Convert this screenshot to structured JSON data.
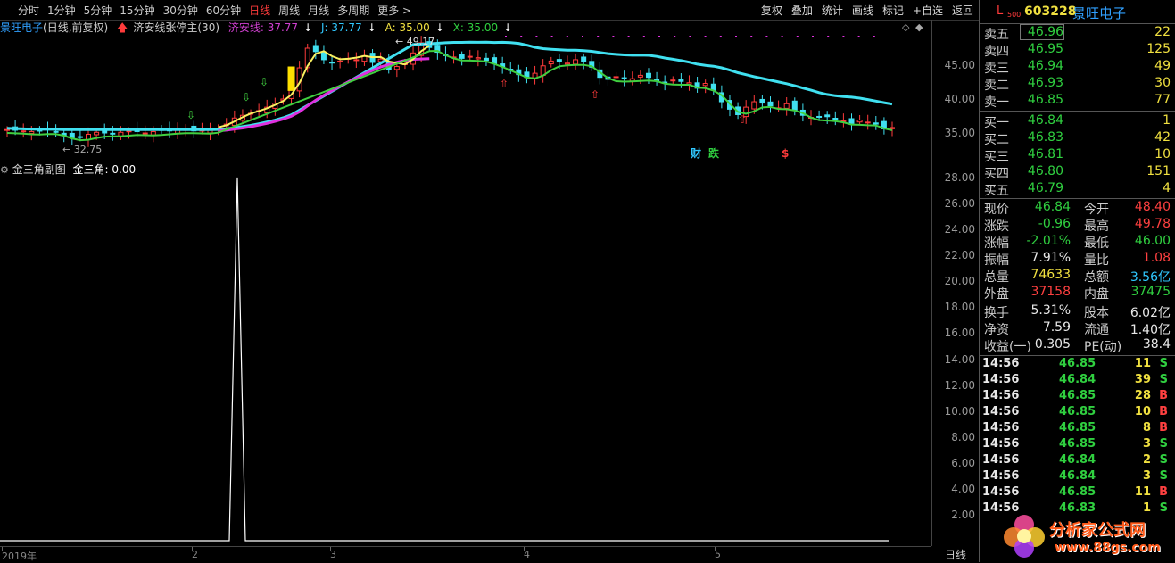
{
  "toolbar": {
    "periods": [
      "分时",
      "1分钟",
      "5分钟",
      "15分钟",
      "30分钟",
      "60分钟",
      "日线",
      "周线",
      "月线",
      "多周期",
      "更多"
    ],
    "active_period": "日线",
    "right_buttons": [
      "复权",
      "叠加",
      "统计",
      "画线",
      "标记",
      "+自选",
      "返回"
    ]
  },
  "main_chart": {
    "name": "景旺电子",
    "mode": "(日线,前复权)",
    "indicator": "济安线张停主(30)",
    "ja_label": "济安线: 37.77",
    "j_label": "J: 37.77",
    "a_label": "A: 35.00",
    "x_label": "X: 35.00",
    "high_marker": "49.17",
    "low_marker": "32.75",
    "price_ticks": [
      "45.00",
      "40.00",
      "35.00"
    ],
    "markers": [
      {
        "text": "财",
        "color": "#30c8ff"
      },
      {
        "text": "跌",
        "color": "#30d040"
      },
      {
        "text": "$",
        "color": "#ff3b3b"
      }
    ]
  },
  "sub_chart": {
    "title": "金三角副图",
    "value_label": "金三角: 0.00",
    "ticks": [
      "28.00",
      "26.00",
      "24.00",
      "22.00",
      "20.00",
      "18.00",
      "16.00",
      "14.00",
      "12.00",
      "10.00",
      "8.00",
      "6.00",
      "4.00",
      "2.00"
    ]
  },
  "date_axis": [
    "2019年",
    "2",
    "3",
    "4",
    "5"
  ],
  "period_label": "日线",
  "stock": {
    "prefix": "L",
    "index_tag": "500",
    "code": "603228",
    "name": "景旺电子"
  },
  "order_book": {
    "sell": [
      {
        "label": "卖五",
        "price": "46.96",
        "volume": "22"
      },
      {
        "label": "卖四",
        "price": "46.95",
        "volume": "125"
      },
      {
        "label": "卖三",
        "price": "46.94",
        "volume": "49"
      },
      {
        "label": "卖二",
        "price": "46.93",
        "volume": "30"
      },
      {
        "label": "卖一",
        "price": "46.85",
        "volume": "77"
      }
    ],
    "buy": [
      {
        "label": "买一",
        "price": "46.84",
        "volume": "1"
      },
      {
        "label": "买二",
        "price": "46.83",
        "volume": "42"
      },
      {
        "label": "买三",
        "price": "46.81",
        "volume": "10"
      },
      {
        "label": "买四",
        "price": "46.80",
        "volume": "151"
      },
      {
        "label": "买五",
        "price": "46.79",
        "volume": "4"
      }
    ]
  },
  "quote": [
    {
      "l1": "现价",
      "v1": "46.84",
      "c1": "green",
      "l2": "今开",
      "v2": "48.40",
      "c2": "red"
    },
    {
      "l1": "涨跌",
      "v1": "-0.96",
      "c1": "green",
      "l2": "最高",
      "v2": "49.78",
      "c2": "red"
    },
    {
      "l1": "涨幅",
      "v1": "-2.01%",
      "c1": "green",
      "l2": "最低",
      "v2": "46.00",
      "c2": "green"
    },
    {
      "l1": "振幅",
      "v1": "7.91%",
      "c1": "white",
      "l2": "量比",
      "v2": "1.08",
      "c2": "red"
    },
    {
      "l1": "总量",
      "v1": "74633",
      "c1": "yellow",
      "l2": "总额",
      "v2": "3.56亿",
      "c2": "cyan"
    },
    {
      "l1": "外盘",
      "v1": "37158",
      "c1": "red",
      "l2": "内盘",
      "v2": "37475",
      "c2": "green"
    }
  ],
  "fundamentals": [
    {
      "l1": "换手",
      "v1": "5.31%",
      "l2": "股本",
      "v2": "6.02亿"
    },
    {
      "l1": "净资",
      "v1": "7.59",
      "l2": "流通",
      "v2": "1.40亿"
    },
    {
      "l1": "收益(一)",
      "v1": "0.305",
      "l2": "PE(动)",
      "v2": "38.4"
    }
  ],
  "ticks": [
    {
      "time": "14:56",
      "price": "46.85",
      "volume": "11",
      "side": "S"
    },
    {
      "time": "14:56",
      "price": "46.84",
      "volume": "39",
      "side": "S"
    },
    {
      "time": "14:56",
      "price": "46.85",
      "volume": "28",
      "side": "B"
    },
    {
      "time": "14:56",
      "price": "46.85",
      "volume": "10",
      "side": "B"
    },
    {
      "time": "14:56",
      "price": "46.85",
      "volume": "8",
      "side": "B"
    },
    {
      "time": "14:56",
      "price": "46.85",
      "volume": "3",
      "side": "S"
    },
    {
      "time": "14:56",
      "price": "46.84",
      "volume": "2",
      "side": "S"
    },
    {
      "time": "14:56",
      "price": "46.84",
      "volume": "3",
      "side": "S"
    },
    {
      "time": "14:56",
      "price": "46.85",
      "volume": "11",
      "side": "B"
    },
    {
      "time": "14:56",
      "price": "46.83",
      "volume": "1",
      "side": "S"
    }
  ],
  "watermark": {
    "title": "分析家公式网",
    "url": "www.88gs.com"
  }
}
